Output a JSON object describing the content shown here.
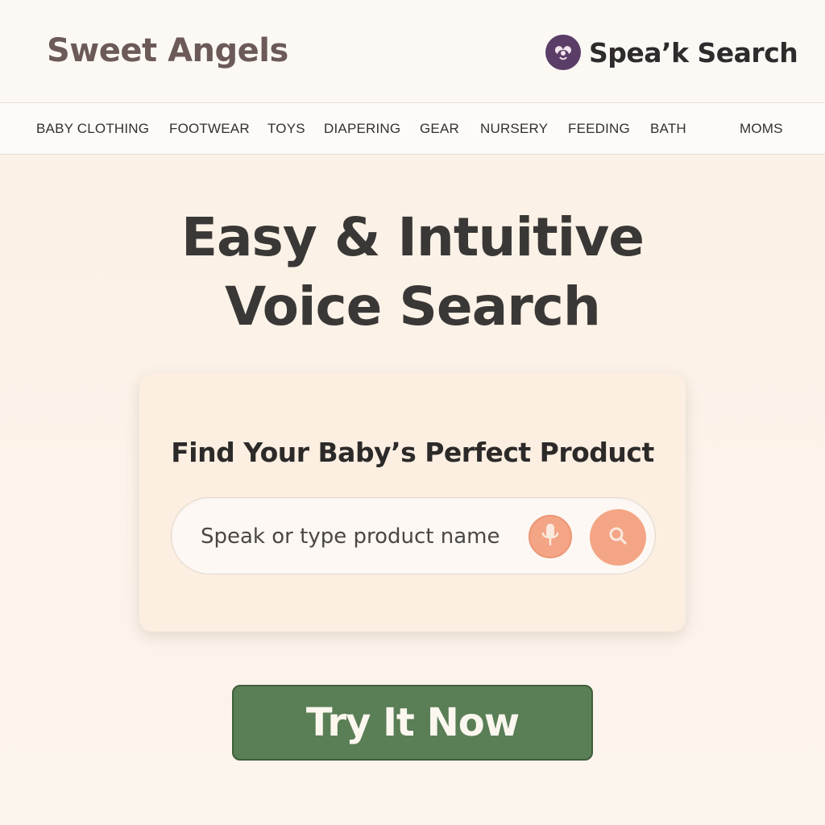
{
  "header": {
    "brand": "Sweet Angels",
    "partner_logo": {
      "name": "Spea’k Search",
      "icon": "speak-search-logo-icon",
      "color": "#5a3e68"
    }
  },
  "nav": {
    "items": [
      {
        "label": "BABY CLOTHING"
      },
      {
        "label": "FOOTWEAR"
      },
      {
        "label": "TOYS"
      },
      {
        "label": "DIAPERING"
      },
      {
        "label": "GEAR"
      },
      {
        "label": "NURSERY"
      },
      {
        "label": "FEEDING"
      },
      {
        "label": "BATH"
      },
      {
        "label": "MOMS"
      }
    ]
  },
  "hero": {
    "line1": "Easy & Intuitive",
    "line2": "Voice Search"
  },
  "search_card": {
    "title": "Find Your Baby’s Perfect Product",
    "input_placeholder": "Speak or type product name",
    "input_value": "",
    "mic_icon": "microphone-icon",
    "search_icon": "magnifier-icon",
    "accent_color": "#f4a585"
  },
  "cta": {
    "label": "Try It Now",
    "color": "#5a7e56"
  }
}
